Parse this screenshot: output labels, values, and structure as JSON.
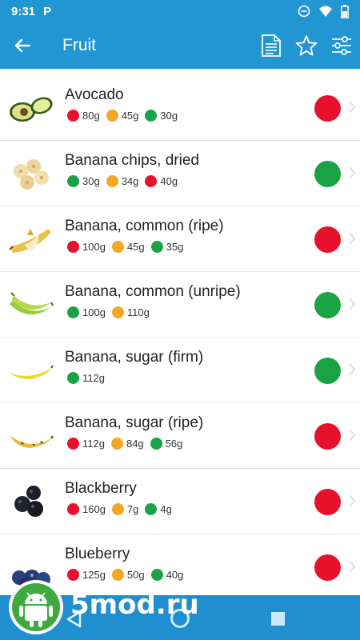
{
  "status": {
    "time": "9:31",
    "app_letter": "P"
  },
  "app_bar": {
    "title": "Fruit"
  },
  "icons": {
    "back": "arrow-back-icon",
    "doc": "document-icon",
    "star": "star-outline-icon",
    "filter": "sliders-icon"
  },
  "colors": {
    "primary": "#2196d3",
    "red": "#e8112d",
    "orange": "#f5a623",
    "green": "#1aa345"
  },
  "items": [
    {
      "name": "Avocado",
      "status": "red",
      "values": [
        {
          "color": "red",
          "text": "80g"
        },
        {
          "color": "orange",
          "text": "45g"
        },
        {
          "color": "green",
          "text": "30g"
        }
      ]
    },
    {
      "name": "Banana chips, dried",
      "status": "green",
      "values": [
        {
          "color": "green",
          "text": "30g"
        },
        {
          "color": "orange",
          "text": "34g"
        },
        {
          "color": "red",
          "text": "40g"
        }
      ]
    },
    {
      "name": "Banana, common (ripe)",
      "status": "red",
      "values": [
        {
          "color": "red",
          "text": "100g"
        },
        {
          "color": "orange",
          "text": "45g"
        },
        {
          "color": "green",
          "text": "35g"
        }
      ]
    },
    {
      "name": "Banana, common (unripe)",
      "status": "green",
      "values": [
        {
          "color": "green",
          "text": "100g"
        },
        {
          "color": "orange",
          "text": "110g"
        }
      ]
    },
    {
      "name": "Banana, sugar (firm)",
      "status": "green",
      "values": [
        {
          "color": "green",
          "text": "112g"
        }
      ]
    },
    {
      "name": "Banana, sugar (ripe)",
      "status": "red",
      "values": [
        {
          "color": "red",
          "text": "112g"
        },
        {
          "color": "orange",
          "text": "84g"
        },
        {
          "color": "green",
          "text": "56g"
        }
      ]
    },
    {
      "name": "Blackberry",
      "status": "red",
      "values": [
        {
          "color": "red",
          "text": "160g"
        },
        {
          "color": "orange",
          "text": "7g"
        },
        {
          "color": "green",
          "text": "4g"
        }
      ]
    },
    {
      "name": "Blueberry",
      "status": "red",
      "values": [
        {
          "color": "red",
          "text": "125g"
        },
        {
          "color": "orange",
          "text": "50g"
        },
        {
          "color": "green",
          "text": "40g"
        }
      ]
    }
  ],
  "watermark": {
    "text": "5mod.ru"
  }
}
